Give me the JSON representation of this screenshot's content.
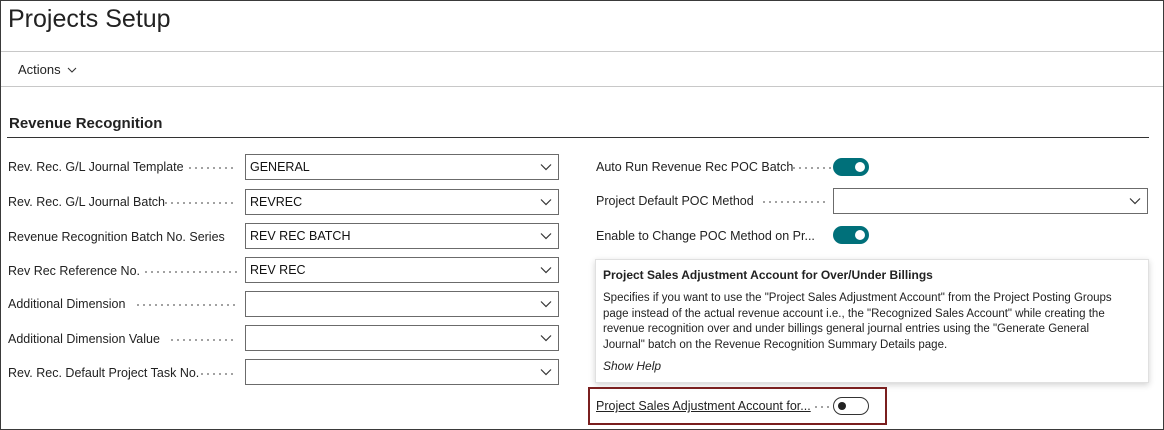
{
  "page": {
    "title": "Projects Setup"
  },
  "actions": {
    "label": "Actions"
  },
  "section": {
    "title": "Revenue Recognition"
  },
  "left_fields": [
    {
      "label": "Rev. Rec. G/L Journal Template",
      "value": "GENERAL"
    },
    {
      "label": "Rev. Rec. G/L Journal Batch",
      "value": "REVREC"
    },
    {
      "label": "Revenue Recognition Batch No. Series",
      "value": "REV REC BATCH"
    },
    {
      "label": "Rev Rec Reference No.",
      "value": "REV REC"
    },
    {
      "label": "Additional Dimension",
      "value": ""
    },
    {
      "label": "Additional Dimension Value",
      "value": ""
    },
    {
      "label": "Rev. Rec. Default Project Task No.",
      "value": ""
    }
  ],
  "right_fields": {
    "auto_run": {
      "label": "Auto Run Revenue Rec POC Batch",
      "enabled": true
    },
    "default_poc": {
      "label": "Project Default POC Method",
      "value": ""
    },
    "enable_change": {
      "label": "Enable to Change POC Method on Pr...",
      "enabled": true
    },
    "sales_adjustment": {
      "label": "Project Sales Adjustment Account for...",
      "enabled": false
    }
  },
  "tooltip": {
    "title": "Project Sales Adjustment Account for Over/Under Billings",
    "lines": [
      "Specifies if you want to use the \"Project Sales Adjustment Account\" from the Project Posting Groups",
      "page instead of the actual revenue account i.e., the \"Recognized Sales Account\" while creating the",
      "revenue recognition over and under billings general journal entries using the \"Generate General",
      "Journal\" batch on the Revenue Recognition Summary Details page."
    ],
    "help": "Show Help"
  },
  "colors": {
    "toggle_on": "#00707a",
    "highlight": "#7a1f1f"
  },
  "icons": {
    "dropdown": "chevron-down-icon"
  }
}
